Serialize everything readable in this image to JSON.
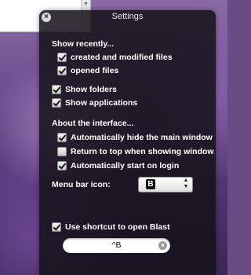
{
  "window": {
    "title": "Settings",
    "close_glyph": "×"
  },
  "sections": {
    "show_recently": "Show recently...",
    "about_interface": "About the interface..."
  },
  "options": {
    "created_modified": {
      "label": "created and modified files",
      "checked": true
    },
    "opened": {
      "label": "opened files",
      "checked": true
    },
    "show_folders": {
      "label": "Show folders",
      "checked": true
    },
    "show_applications": {
      "label": "Show applications",
      "checked": true
    },
    "auto_hide": {
      "label": "Automatically hide the main window",
      "checked": true
    },
    "return_top": {
      "label": "Return to top when showing window",
      "checked": false
    },
    "auto_start": {
      "label": "Automatically start on login",
      "checked": true
    },
    "use_shortcut": {
      "label": "Use shortcut to open Blast",
      "checked": true
    }
  },
  "menu_bar_icon": {
    "label": "Menu bar icon:",
    "selected_glyph": "B"
  },
  "shortcut": {
    "value": "^B"
  },
  "icons": {
    "close": "close-icon",
    "checkmark": "checkmark-icon",
    "popup_arrows": "chevron-updown-icon",
    "clear": "clear-icon"
  },
  "colors": {
    "hud_background": "#141218",
    "text": "#ffffff",
    "desktop": "#6a4c85"
  }
}
